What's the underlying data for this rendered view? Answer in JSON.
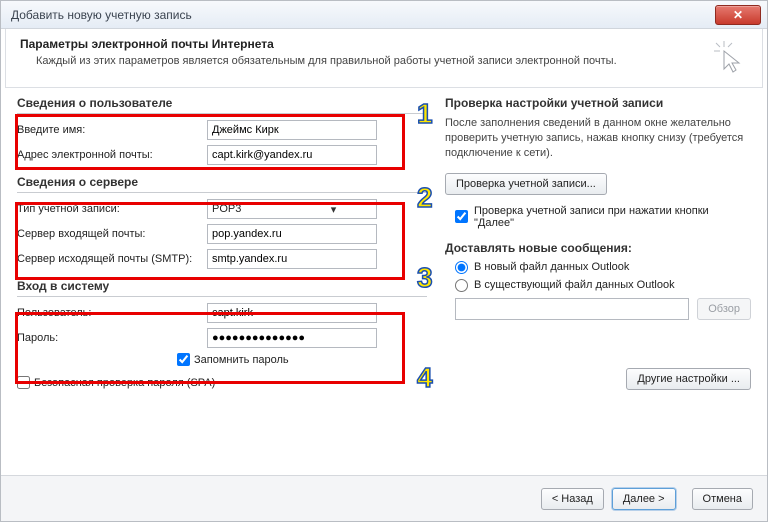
{
  "window": {
    "title": "Добавить новую учетную запись"
  },
  "header": {
    "title": "Параметры электронной почты Интернета",
    "subtitle": "Каждый из этих параметров является обязательным для правильной работы учетной записи электронной почты."
  },
  "user_section": {
    "title": "Сведения о пользователе",
    "name_label": "Введите имя:",
    "name_value": "Джеймс Кирк",
    "email_label": "Адрес электронной почты:",
    "email_value": "capt.kirk@yandex.ru"
  },
  "server_section": {
    "title": "Сведения о сервере",
    "type_label": "Тип учетной записи:",
    "type_value": "POP3",
    "incoming_label": "Сервер входящей почты:",
    "incoming_value": "pop.yandex.ru",
    "outgoing_label": "Сервер исходящей почты (SMTP):",
    "outgoing_value": "smtp.yandex.ru"
  },
  "login_section": {
    "title": "Вход в систему",
    "user_label": "Пользователь:",
    "user_value": "capt.kirk",
    "password_label": "Пароль:",
    "password_value": "●●●●●●●●●●●●●●",
    "remember_label": "Запомнить пароль",
    "spa_label": "Безопасная проверка пароля (SPA)"
  },
  "test_section": {
    "title": "Проверка настройки учетной записи",
    "desc": "После заполнения сведений в данном окне желательно проверить учетную запись, нажав кнопку снизу (требуется подключение к сети).",
    "button": "Проверка учетной записи...",
    "auto_test_label": "Проверка учетной записи при нажатии кнопки \"Далее\""
  },
  "deliver_section": {
    "title": "Доставлять новые сообщения:",
    "opt_new": "В новый файл данных Outlook",
    "opt_existing": "В существующий файл данных Outlook",
    "browse": "Обзор"
  },
  "other_settings": "Другие настройки ...",
  "footer": {
    "back": "< Назад",
    "next": "Далее >",
    "cancel": "Отмена"
  },
  "annotations": {
    "n1": "1",
    "n2": "2",
    "n3": "3",
    "n4": "4"
  }
}
